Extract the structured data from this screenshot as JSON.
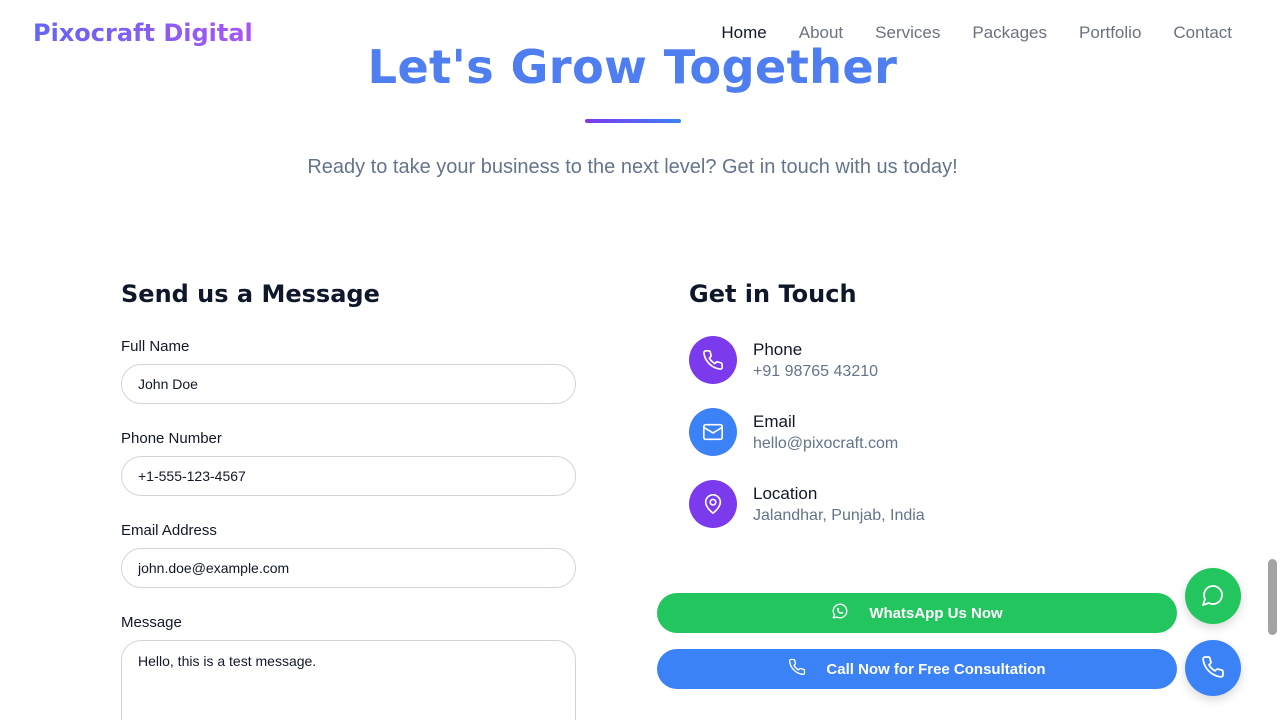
{
  "brand": {
    "name": "Pixocraft Digital"
  },
  "nav": {
    "links": [
      {
        "label": "Home",
        "active": true
      },
      {
        "label": "About",
        "active": false
      },
      {
        "label": "Services",
        "active": false
      },
      {
        "label": "Packages",
        "active": false
      },
      {
        "label": "Portfolio",
        "active": false
      },
      {
        "label": "Contact",
        "active": false
      }
    ]
  },
  "hero": {
    "title": "Let's Grow Together",
    "subtitle": "Ready to take your business to the next level? Get in touch with us today!"
  },
  "form": {
    "title": "Send us a Message",
    "full_name": {
      "label": "Full Name",
      "value": "John Doe"
    },
    "phone": {
      "label": "Phone Number",
      "value": "+1-555-123-4567"
    },
    "email": {
      "label": "Email Address",
      "value": "john.doe@example.com"
    },
    "message": {
      "label": "Message",
      "value": "Hello, this is a test message."
    }
  },
  "contact": {
    "title": "Get in Touch",
    "items": [
      {
        "label": "Phone",
        "value": "+91 98765 43210",
        "icon": "phone-icon",
        "color": "#7c3aed"
      },
      {
        "label": "Email",
        "value": "hello@pixocraft.com",
        "icon": "mail-icon",
        "color": "#3b82f6"
      },
      {
        "label": "Location",
        "value": "Jalandhar, Punjab, India",
        "icon": "map-pin-icon",
        "color": "#7c3aed"
      }
    ]
  },
  "cta": {
    "whatsapp_label": "WhatsApp Us Now",
    "call_label": "Call Now for Free Consultation"
  },
  "colors": {
    "brand_gradient_start": "#6366f1",
    "brand_gradient_end": "#a855f7",
    "whatsapp_green": "#22c55e",
    "call_blue": "#3b82f6",
    "purple": "#7c3aed"
  }
}
